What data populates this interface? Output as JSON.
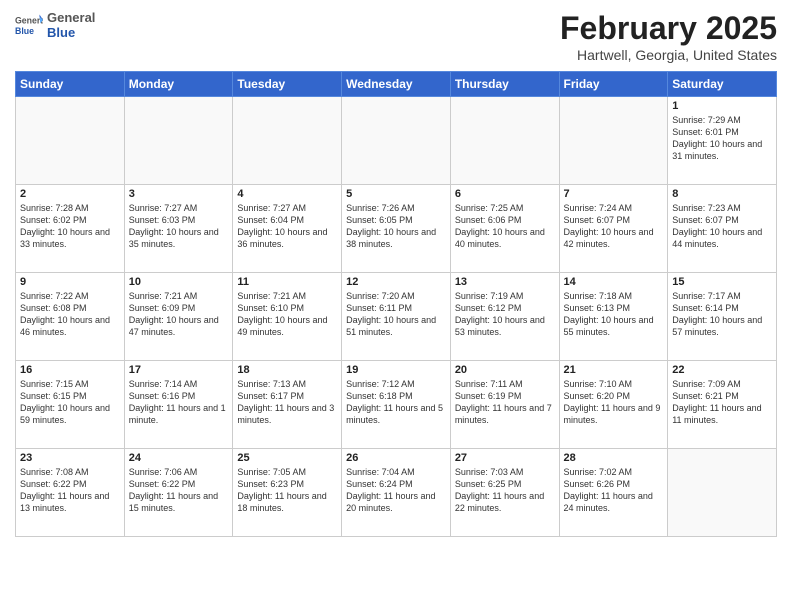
{
  "header": {
    "logo_general": "General",
    "logo_blue": "Blue",
    "title": "February 2025",
    "location": "Hartwell, Georgia, United States"
  },
  "days_of_week": [
    "Sunday",
    "Monday",
    "Tuesday",
    "Wednesday",
    "Thursday",
    "Friday",
    "Saturday"
  ],
  "weeks": [
    [
      {
        "day": "",
        "info": ""
      },
      {
        "day": "",
        "info": ""
      },
      {
        "day": "",
        "info": ""
      },
      {
        "day": "",
        "info": ""
      },
      {
        "day": "",
        "info": ""
      },
      {
        "day": "",
        "info": ""
      },
      {
        "day": "1",
        "info": "Sunrise: 7:29 AM\nSunset: 6:01 PM\nDaylight: 10 hours and 31 minutes."
      }
    ],
    [
      {
        "day": "2",
        "info": "Sunrise: 7:28 AM\nSunset: 6:02 PM\nDaylight: 10 hours and 33 minutes."
      },
      {
        "day": "3",
        "info": "Sunrise: 7:27 AM\nSunset: 6:03 PM\nDaylight: 10 hours and 35 minutes."
      },
      {
        "day": "4",
        "info": "Sunrise: 7:27 AM\nSunset: 6:04 PM\nDaylight: 10 hours and 36 minutes."
      },
      {
        "day": "5",
        "info": "Sunrise: 7:26 AM\nSunset: 6:05 PM\nDaylight: 10 hours and 38 minutes."
      },
      {
        "day": "6",
        "info": "Sunrise: 7:25 AM\nSunset: 6:06 PM\nDaylight: 10 hours and 40 minutes."
      },
      {
        "day": "7",
        "info": "Sunrise: 7:24 AM\nSunset: 6:07 PM\nDaylight: 10 hours and 42 minutes."
      },
      {
        "day": "8",
        "info": "Sunrise: 7:23 AM\nSunset: 6:07 PM\nDaylight: 10 hours and 44 minutes."
      }
    ],
    [
      {
        "day": "9",
        "info": "Sunrise: 7:22 AM\nSunset: 6:08 PM\nDaylight: 10 hours and 46 minutes."
      },
      {
        "day": "10",
        "info": "Sunrise: 7:21 AM\nSunset: 6:09 PM\nDaylight: 10 hours and 47 minutes."
      },
      {
        "day": "11",
        "info": "Sunrise: 7:21 AM\nSunset: 6:10 PM\nDaylight: 10 hours and 49 minutes."
      },
      {
        "day": "12",
        "info": "Sunrise: 7:20 AM\nSunset: 6:11 PM\nDaylight: 10 hours and 51 minutes."
      },
      {
        "day": "13",
        "info": "Sunrise: 7:19 AM\nSunset: 6:12 PM\nDaylight: 10 hours and 53 minutes."
      },
      {
        "day": "14",
        "info": "Sunrise: 7:18 AM\nSunset: 6:13 PM\nDaylight: 10 hours and 55 minutes."
      },
      {
        "day": "15",
        "info": "Sunrise: 7:17 AM\nSunset: 6:14 PM\nDaylight: 10 hours and 57 minutes."
      }
    ],
    [
      {
        "day": "16",
        "info": "Sunrise: 7:15 AM\nSunset: 6:15 PM\nDaylight: 10 hours and 59 minutes."
      },
      {
        "day": "17",
        "info": "Sunrise: 7:14 AM\nSunset: 6:16 PM\nDaylight: 11 hours and 1 minute."
      },
      {
        "day": "18",
        "info": "Sunrise: 7:13 AM\nSunset: 6:17 PM\nDaylight: 11 hours and 3 minutes."
      },
      {
        "day": "19",
        "info": "Sunrise: 7:12 AM\nSunset: 6:18 PM\nDaylight: 11 hours and 5 minutes."
      },
      {
        "day": "20",
        "info": "Sunrise: 7:11 AM\nSunset: 6:19 PM\nDaylight: 11 hours and 7 minutes."
      },
      {
        "day": "21",
        "info": "Sunrise: 7:10 AM\nSunset: 6:20 PM\nDaylight: 11 hours and 9 minutes."
      },
      {
        "day": "22",
        "info": "Sunrise: 7:09 AM\nSunset: 6:21 PM\nDaylight: 11 hours and 11 minutes."
      }
    ],
    [
      {
        "day": "23",
        "info": "Sunrise: 7:08 AM\nSunset: 6:22 PM\nDaylight: 11 hours and 13 minutes."
      },
      {
        "day": "24",
        "info": "Sunrise: 7:06 AM\nSunset: 6:22 PM\nDaylight: 11 hours and 15 minutes."
      },
      {
        "day": "25",
        "info": "Sunrise: 7:05 AM\nSunset: 6:23 PM\nDaylight: 11 hours and 18 minutes."
      },
      {
        "day": "26",
        "info": "Sunrise: 7:04 AM\nSunset: 6:24 PM\nDaylight: 11 hours and 20 minutes."
      },
      {
        "day": "27",
        "info": "Sunrise: 7:03 AM\nSunset: 6:25 PM\nDaylight: 11 hours and 22 minutes."
      },
      {
        "day": "28",
        "info": "Sunrise: 7:02 AM\nSunset: 6:26 PM\nDaylight: 11 hours and 24 minutes."
      },
      {
        "day": "",
        "info": ""
      }
    ]
  ]
}
